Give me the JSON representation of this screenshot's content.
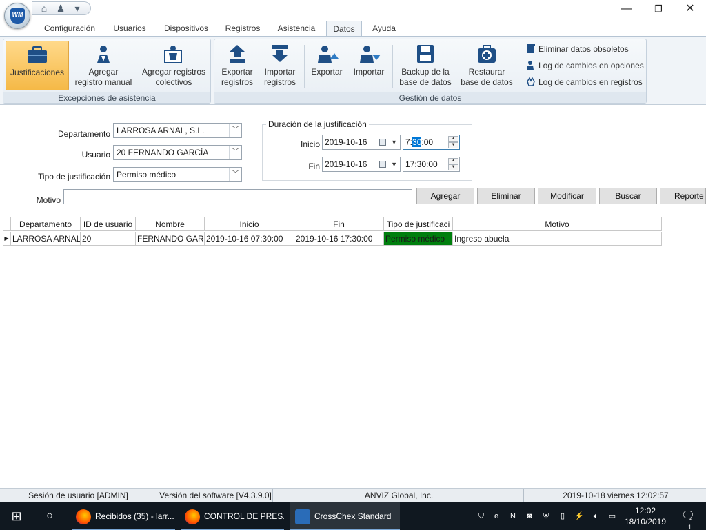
{
  "window": {
    "logo_text": "WM",
    "minimize": "—",
    "restore": "❐",
    "close": "✕"
  },
  "quick_access": {
    "home": "⌂",
    "users": "♟",
    "menu": "▾"
  },
  "tabs": [
    {
      "label": "Configuración"
    },
    {
      "label": "Usuarios"
    },
    {
      "label": "Dispositivos"
    },
    {
      "label": "Registros"
    },
    {
      "label": "Asistencia"
    },
    {
      "label": "Datos"
    },
    {
      "label": "Ayuda"
    }
  ],
  "active_tab": "Datos",
  "ribbon": {
    "group1": {
      "caption": "Excepciones de asistencia",
      "justificaciones": "Justificaciones",
      "agregar_manual_1": "Agregar",
      "agregar_manual_2": "registro manual",
      "agregar_colectivos_1": "Agregar registros",
      "agregar_colectivos_2": "colectivos"
    },
    "group2": {
      "caption": "Gestión de datos",
      "exportar_registros_1": "Exportar",
      "exportar_registros_2": "registros",
      "importar_registros_1": "Importar",
      "importar_registros_2": "registros",
      "exportar": "Exportar",
      "importar": "Importar",
      "backup_1": "Backup de la",
      "backup_2": "base de datos",
      "restaurar_1": "Restaurar",
      "restaurar_2": "base de datos",
      "eliminar_obsoletos": "Eliminar datos obsoletos",
      "log_opciones": "Log de cambios en opciones",
      "log_registros": "Log de cambios en registros"
    }
  },
  "form": {
    "departamento_label": "Departamento",
    "departamento_value": "LARROSA ARNAL, S.L.",
    "usuario_label": "Usuario",
    "usuario_value": "20   FERNANDO GARCÍA",
    "tipo_label": "Tipo de justificación",
    "tipo_value": "Permiso médico",
    "motivo_label": "Motivo",
    "motivo_value": "",
    "duracion_legend": "Duración de la justificación",
    "inicio_label": "Inicio",
    "inicio_date": "2019-10-16",
    "inicio_time_h": "7:",
    "inicio_time_m": "30",
    "inicio_time_s": ":00",
    "fin_label": "Fin",
    "fin_date": "2019-10-16",
    "fin_time": "17:30:00"
  },
  "actions": {
    "agregar": "Agregar",
    "eliminar": "Eliminar",
    "modificar": "Modificar",
    "buscar": "Buscar",
    "reporte": "Reporte"
  },
  "grid": {
    "headers": [
      "Departamento",
      "ID de usuario",
      "Nombre",
      "Inicio",
      "Fin",
      "Tipo de justificaci",
      "Motivo"
    ],
    "rows": [
      [
        "LARROSA ARNAL,",
        "20",
        "FERNANDO GARC",
        "2019-10-16 07:30:00",
        "2019-10-16 17:30:00",
        "Permiso médico",
        "Ingreso abuela"
      ]
    ],
    "highlight_color": "#007f0e"
  },
  "status": {
    "session": "Sesión de usuario  [ADMIN]",
    "version": "Versión del software  [V4.3.9.0]",
    "company": "ANVIZ Global, Inc.",
    "datetime": "2019-10-18 viernes 12:02:57"
  },
  "taskbar": {
    "item1": "Recibidos (35) - larr...",
    "item2": "CONTROL DE PRES...",
    "item3": "CrossChex Standard",
    "time": "12:02",
    "date": "18/10/2019",
    "notif_count": "1"
  }
}
